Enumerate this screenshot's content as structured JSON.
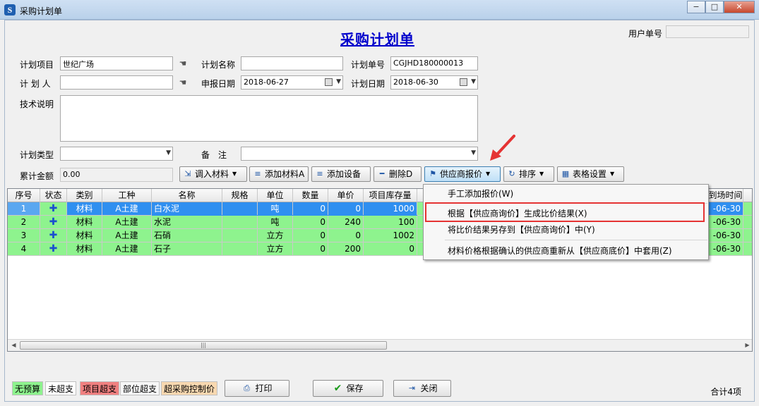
{
  "window": {
    "title": "采购计划单",
    "min": "−",
    "max": "□",
    "close": "✕"
  },
  "page": {
    "title": "采购计划单"
  },
  "header": {
    "user_no_label": "用户单号",
    "user_no_value": ""
  },
  "form": {
    "project_label": "计划项目",
    "project_value": "世纪广场",
    "name_label": "计划名称",
    "name_value": "",
    "plan_no_label": "计划单号",
    "plan_no_value": "CGJHD180000013",
    "planner_label": "计 划 人",
    "planner_value": "",
    "report_date_label": "申报日期",
    "report_date_value": "2018-06-27",
    "plan_date_label": "计划日期",
    "plan_date_value": "2018-06-30",
    "tech_label": "技术说明",
    "tech_value": "",
    "type_label": "计划类型",
    "type_value": "",
    "remark_label": "备　注",
    "remark_value": "",
    "total_label": "累计金额",
    "total_value": "0.00"
  },
  "toolbar": {
    "import_label": "调入材料",
    "add_material_label": "添加材料A",
    "add_device_label": "添加设备",
    "delete_label": "删除D",
    "supplier_quote_label": "供应商报价",
    "sort_label": "排序",
    "table_settings_label": "表格设置"
  },
  "grid": {
    "columns": [
      "序号",
      "状态",
      "类别",
      "工种",
      "名称",
      "规格",
      "单位",
      "数量",
      "单价",
      "项目库存量",
      "到场时间"
    ],
    "rows": [
      {
        "no": "1",
        "category": "材料",
        "trade": "A土建",
        "name": "白水泥",
        "spec": "",
        "unit": "吨",
        "qty": "0",
        "price": "0",
        "stock": "1000",
        "arrive": "-06-30"
      },
      {
        "no": "2",
        "category": "材料",
        "trade": "A土建",
        "name": "水泥",
        "spec": "",
        "unit": "吨",
        "qty": "0",
        "price": "240",
        "stock": "100",
        "arrive": "-06-30"
      },
      {
        "no": "3",
        "category": "材料",
        "trade": "A土建",
        "name": "石硝",
        "spec": "",
        "unit": "立方",
        "qty": "0",
        "price": "0",
        "stock": "1002",
        "arrive": "-06-30"
      },
      {
        "no": "4",
        "category": "材料",
        "trade": "A土建",
        "name": "石子",
        "spec": "",
        "unit": "立方",
        "qty": "0",
        "price": "200",
        "stock": "0",
        "arrive": "-06-30"
      }
    ]
  },
  "menu": {
    "items": [
      "手工添加报价(W)",
      "根据【供应商询价】生成比价结果(X)",
      "将比价结果另存到【供应商询价】中(Y)",
      "材料价格根据确认的供应商重新从【供应商底价】中套用(Z)"
    ]
  },
  "legend": [
    "无预算",
    "未超支",
    "项目超支",
    "部位超支",
    "超采购控制价"
  ],
  "colors": {
    "no_budget": "#8ef38e",
    "not_over": "#ffffff",
    "project_over": "#f08080",
    "part_over": "#f7f7f7",
    "over_control": "#f8d8b0",
    "highlight": "#e53333"
  },
  "footer": {
    "print_label": "打印",
    "save_label": "保存",
    "close_label": "关闭",
    "total_count": "合计4项"
  }
}
